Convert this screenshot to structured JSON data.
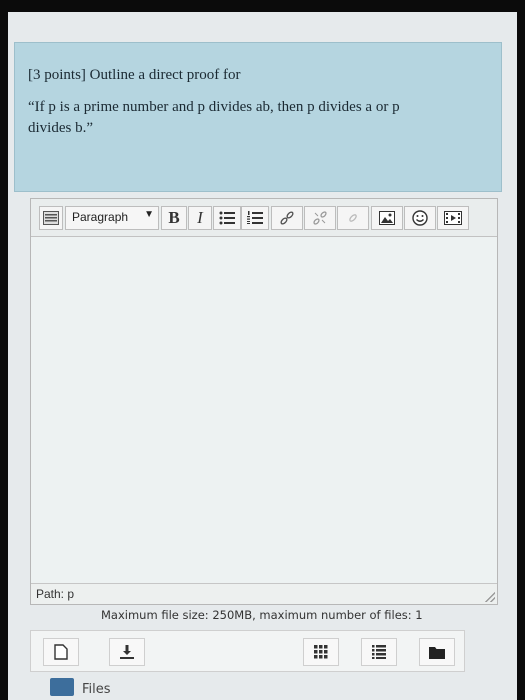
{
  "question": {
    "points": "[3 points]",
    "prompt": "Outline a direct proof for",
    "statement_line1": "“If p is a prime number and p divides ab, then p divides a or p",
    "statement_line2": "divides b.”"
  },
  "editor": {
    "toolbar": {
      "format_select": "Paragraph",
      "bold_label": "B",
      "italic_label": "I"
    },
    "path_label": "Path: p"
  },
  "file_limits": "Maximum file size: 250MB, maximum number of files: 1",
  "file_area": {
    "files_label": "Files"
  },
  "icons": {
    "toolbar_toggle": "toolbar-toggle-icon",
    "unordered_list": "unordered-list-icon",
    "ordered_list": "ordered-list-icon",
    "link": "link-icon",
    "unlink": "unlink-icon",
    "anchor": "anchor-icon",
    "image": "image-icon",
    "emoticon": "emoticon-icon",
    "media": "media-icon",
    "add_file": "add-file-icon",
    "download": "download-icon",
    "grid_view": "grid-view-icon",
    "list_view": "list-view-icon",
    "folder_view": "folder-view-icon",
    "folder": "folder-icon"
  },
  "colors": {
    "question_bg": "#b5d5e0",
    "accent": "#3d6e9c"
  }
}
